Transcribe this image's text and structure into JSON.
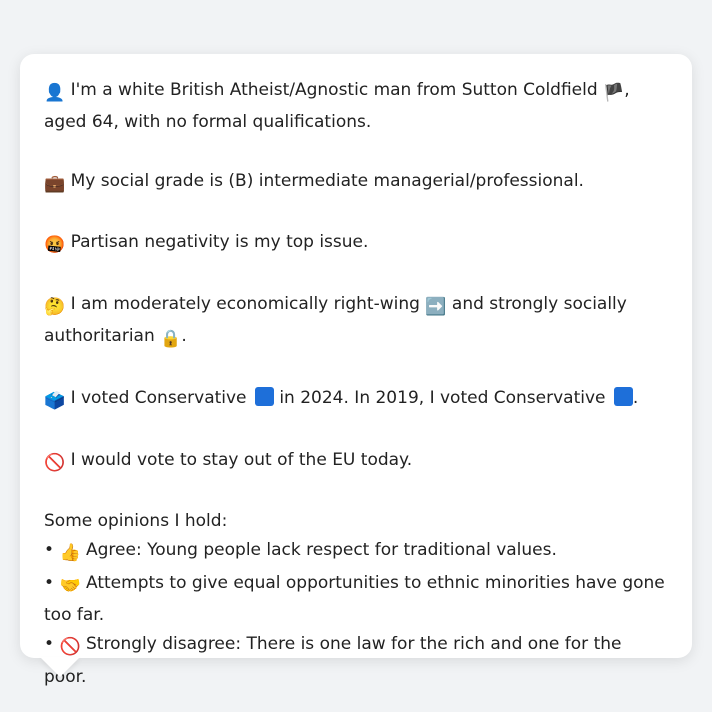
{
  "intro": {
    "icon": "👤",
    "text_before_flag": "I'm a white British Atheist/Agnostic man from Sutton Coldfield",
    "flag": "🏴",
    "text_after_flag": ", aged 64, with no formal qualifications."
  },
  "social_grade": {
    "icon": "💼",
    "text": "My social grade is (B) intermediate managerial/professional."
  },
  "top_issue": {
    "icon": "🤬",
    "text": "Partisan negativity is my top issue."
  },
  "ideology": {
    "icon": "🤔",
    "text_before_arrow": "I am moderately economically right-wing",
    "arrow": "➡️",
    "text_middle": "and strongly socially authoritarian",
    "lock": "🔒",
    "text_end": "."
  },
  "votes": {
    "icon": "🗳️",
    "text_part1": "I voted Conservative",
    "text_part2": "in 2024. In 2019, I voted Conservative",
    "text_end": ".",
    "conservative_color": "#1e6fd9"
  },
  "eu": {
    "icon": "🚫",
    "text": "I would vote to stay out of the EU today."
  },
  "opinions": {
    "heading": "Some opinions I hold:",
    "bullet": "•",
    "items": [
      {
        "icon": "👍",
        "text": "Agree: Young people lack respect for traditional values."
      },
      {
        "icon": "🤝",
        "text": "Attempts to give equal opportunities to ethnic minorities have gone too far."
      },
      {
        "icon": "🚫",
        "text": "Strongly disagree: There is one law for the rich and one for the poor."
      }
    ]
  }
}
